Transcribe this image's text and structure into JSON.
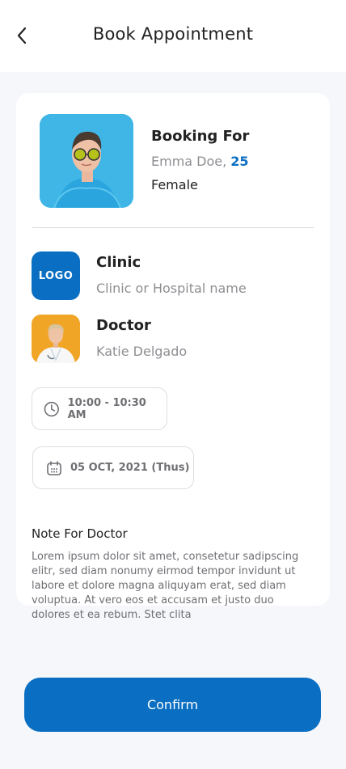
{
  "header": {
    "title": "Book Appointment",
    "back_icon": "chevron-left-icon"
  },
  "patient": {
    "section_label": "Booking For",
    "name": "Emma Doe, ",
    "age": "25",
    "gender": "Female"
  },
  "clinic": {
    "logo_text": "LOGO",
    "label": "Clinic",
    "name": "Clinic or Hospital name",
    "brand_color": "#0a6fc2"
  },
  "doctor": {
    "label": "Doctor",
    "name": "Katie Delgado"
  },
  "appointment": {
    "time": "10:00 - 10:30 AM",
    "time_icon": "clock-icon",
    "date": "05 OCT, 2021 (Thus)",
    "date_icon": "calendar-icon"
  },
  "note": {
    "label": "Note For Doctor",
    "text": "Lorem ipsum dolor sit amet, consetetur sadipscing elitr, sed diam nonumy eirmod tempor invidunt ut labore et dolore magna aliquyam erat, sed diam voluptua. At vero eos et accusam et justo duo dolores et ea rebum. Stet clita"
  },
  "actions": {
    "confirm_label": "Confirm",
    "accent_color": "#0a6fc2"
  }
}
